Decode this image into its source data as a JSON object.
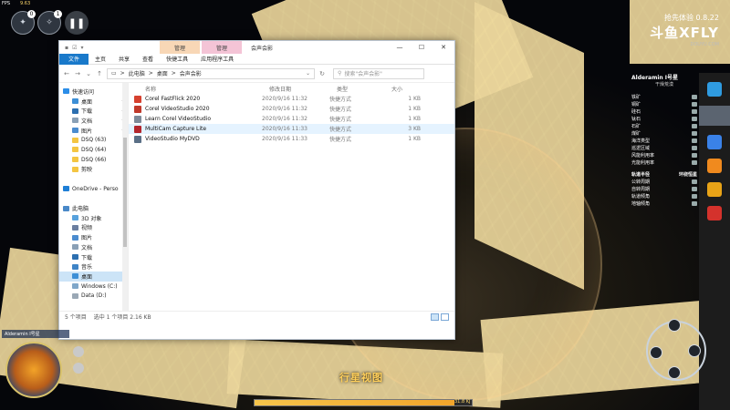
{
  "hud": {
    "fps_label": "FPS",
    "fps_value": "9.63",
    "round_buttons": [
      {
        "badge": "0"
      },
      {
        "badge": "1"
      }
    ]
  },
  "watermark": {
    "line1": "抢先体验 0.8.22",
    "brand": "斗鱼XFLY",
    "sub": "DOUYU.COM"
  },
  "resource_panel": {
    "title": "Alderamin I号星",
    "subtitle": "干燥荒漠",
    "rows": [
      "铁矿",
      "铜矿",
      "硅石",
      "钛石",
      "石矿",
      "煤矿",
      "海洋类型",
      "巡逻区域",
      "风能利用率",
      "光能利用率"
    ],
    "section_headers": [
      "轨道半径",
      "环绕恒星"
    ],
    "section_rows": [
      "公转周期",
      "自转周期",
      "轨道倾角",
      "地轴倾角"
    ]
  },
  "window": {
    "quick_access_icons": [
      "save-icon",
      "folder-icon"
    ],
    "context_tabs": [
      "管理",
      "管理"
    ],
    "title": "会声会影",
    "controls": [
      "—",
      "☐",
      "✕"
    ],
    "ribbon_tabs": [
      "文件",
      "主页",
      "共享",
      "查看",
      "快捷工具",
      "应用程序工具"
    ],
    "address": {
      "crumbs": [
        "此电脑",
        "桌面",
        "会声会影"
      ],
      "separator": ">"
    },
    "search_placeholder": "搜索\"会声会影\"",
    "nav": [
      {
        "label": "快速访问",
        "indent": false,
        "color": "#2c8ee8",
        "pin": false
      },
      {
        "label": "桌面",
        "indent": true,
        "color": "#3d8fd6",
        "pin": true
      },
      {
        "label": "下载",
        "indent": true,
        "color": "#2c6fb0",
        "pin": true
      },
      {
        "label": "文档",
        "indent": true,
        "color": "#8aa0b6",
        "pin": true
      },
      {
        "label": "图片",
        "indent": true,
        "color": "#4b8ccf",
        "pin": true
      },
      {
        "label": "DSQ (63)",
        "indent": true,
        "color": "#f4c542",
        "pin": false
      },
      {
        "label": "DSQ (64)",
        "indent": true,
        "color": "#f4c542",
        "pin": false
      },
      {
        "label": "DSQ (66)",
        "indent": true,
        "color": "#f4c542",
        "pin": false
      },
      {
        "label": "剪映",
        "indent": true,
        "color": "#f4c542",
        "pin": false
      },
      {
        "label": "",
        "indent": false,
        "color": "transparent",
        "pin": false
      },
      {
        "label": "OneDrive - Perso",
        "indent": false,
        "color": "#1f7fd6",
        "pin": false
      },
      {
        "label": "",
        "indent": false,
        "color": "transparent",
        "pin": false
      },
      {
        "label": "此电脑",
        "indent": false,
        "color": "#4a89c8",
        "pin": false
      },
      {
        "label": "3D 对象",
        "indent": true,
        "color": "#58a2dd",
        "pin": false
      },
      {
        "label": "视频",
        "indent": true,
        "color": "#6b7fa0",
        "pin": false
      },
      {
        "label": "图片",
        "indent": true,
        "color": "#4b8ccf",
        "pin": false
      },
      {
        "label": "文档",
        "indent": true,
        "color": "#8aa0b6",
        "pin": false
      },
      {
        "label": "下载",
        "indent": true,
        "color": "#2c6fb0",
        "pin": false
      },
      {
        "label": "音乐",
        "indent": true,
        "color": "#3f84c6",
        "pin": false
      },
      {
        "label": "桌面",
        "indent": true,
        "color": "#3d8fd6",
        "pin": false,
        "selected": true
      },
      {
        "label": "Windows (C:)",
        "indent": true,
        "color": "#7fa7c9",
        "pin": false
      },
      {
        "label": "Data (D:)",
        "indent": true,
        "color": "#9aa8b5",
        "pin": false
      }
    ],
    "columns": {
      "name": "名称",
      "date": "修改日期",
      "type": "类型",
      "size": "大小"
    },
    "files": [
      {
        "name": "Corel FastFlick 2020",
        "date": "2020/9/16 11:32",
        "type": "快捷方式",
        "size": "1 KB",
        "color": "#d6412f"
      },
      {
        "name": "Corel VideoStudio 2020",
        "date": "2020/9/16 11:32",
        "type": "快捷方式",
        "size": "1 KB",
        "color": "#c0392b"
      },
      {
        "name": "Learn Corel VideoStudio",
        "date": "2020/9/16 11:32",
        "type": "快捷方式",
        "size": "1 KB",
        "color": "#7d8a99"
      },
      {
        "name": "MultiCam Capture Lite",
        "date": "2020/9/16 11:33",
        "type": "快捷方式",
        "size": "3 KB",
        "color": "#b3262d",
        "highlight": true
      },
      {
        "name": "VideoStudio MyDVD",
        "date": "2020/9/16 11:33",
        "type": "快捷方式",
        "size": "1 KB",
        "color": "#5a6f86"
      }
    ],
    "status": {
      "items": "5 个项目",
      "selected": "选中 1 个项目  2.16 KB"
    }
  },
  "bottom_hud": {
    "minimap_label": "Alderamin I号星",
    "planet_view": "行星视图",
    "energy_value": "31.8 KJ",
    "energy_fraction": 0.92
  }
}
